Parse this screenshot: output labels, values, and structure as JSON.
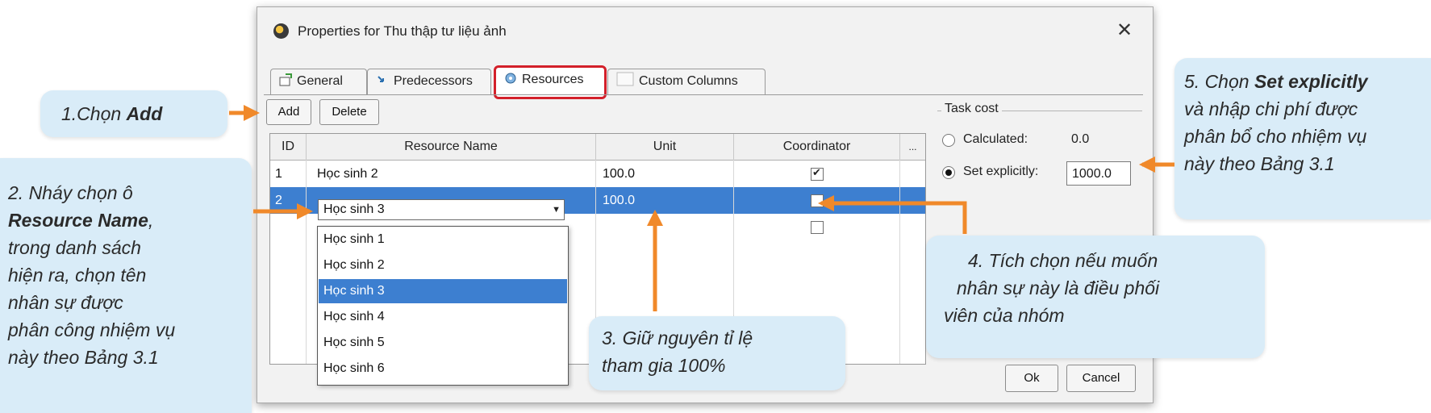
{
  "dialog": {
    "title": "Properties for Thu thập tư liệu ảnh",
    "close_glyph": "✕"
  },
  "tabs": [
    {
      "label": "General",
      "icon": "general-icon"
    },
    {
      "label": "Predecessors",
      "icon": "predecessors-icon"
    },
    {
      "label": "Resources",
      "icon": "resources-icon",
      "active": true
    },
    {
      "label": "Custom Columns",
      "icon": "custom-columns-icon"
    }
  ],
  "toolbar": {
    "add_label": "Add",
    "delete_label": "Delete"
  },
  "table": {
    "columns": [
      "ID",
      "Resource Name",
      "Unit",
      "Coordinator",
      "..."
    ],
    "rows": [
      {
        "id": "1",
        "name": "Học sinh 2",
        "unit": "100.0",
        "coordinator": true
      },
      {
        "id": "2",
        "name": "Học sinh 3",
        "unit": "100.0",
        "coordinator": false,
        "selected": true
      }
    ],
    "dropdown_options": [
      "Học sinh 1",
      "Học sinh 2",
      "Học sinh 3",
      "Học sinh 4",
      "Học sinh 5",
      "Học sinh 6"
    ],
    "dropdown_selected": "Học sinh 3"
  },
  "task_cost": {
    "legend": "Task cost",
    "calculated_label": "Calculated:",
    "calculated_value": "0.0",
    "explicit_label": "Set explicitly:",
    "explicit_value": "1000.0",
    "selected": "explicit"
  },
  "footer": {
    "ok_label": "Ok",
    "cancel_label": "Cancel"
  },
  "callouts": {
    "c1_prefix": "1.Chọn ",
    "c1_bold": "Add",
    "c2_l1": "2. Nháy chọn ô",
    "c2_l2_bold": "Resource Name",
    "c2_l2_rest": ",",
    "c2_l3": "trong danh sách",
    "c2_l4": "hiện ra, chọn tên",
    "c2_l5": "nhân sự được",
    "c2_l6": "phân công nhiệm vụ",
    "c2_l7": "này theo Bảng 3.1",
    "c3_l1": "3. Giữ nguyên tỉ lệ",
    "c3_l2": "tham gia 100%",
    "c4_l1": "4. Tích chọn nếu muốn",
    "c4_l2": "nhân sự này là điều phối",
    "c4_l3": "viên của nhóm",
    "c5_l1_prefix": "5. Chọn ",
    "c5_l1_bold": "Set explicitly",
    "c5_l2": "và nhập chi phí được",
    "c5_l3": "phân bổ cho nhiệm vụ",
    "c5_l4": "này theo Bảng 3.1"
  },
  "colors": {
    "accent_arrow": "#f0892a",
    "callout_bg": "#d9ecf8",
    "selection": "#3d7fd0",
    "active_tab_border": "#d3202a"
  }
}
